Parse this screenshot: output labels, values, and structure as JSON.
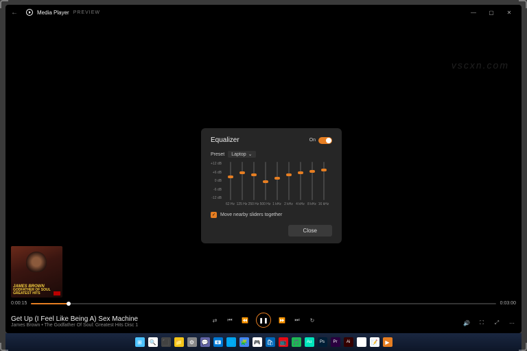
{
  "titlebar": {
    "app": "Media Player",
    "badge": "PREVIEW"
  },
  "album": {
    "line1": "JAMES BROWN",
    "line2": "GODFATHER OF SOUL",
    "line3": "GREATEST HITS"
  },
  "seek": {
    "elapsed": "0:00:15",
    "total": "0:03:00",
    "pct": 8
  },
  "now": {
    "song": "Get Up (I Feel Like Being A) Sex Machine",
    "artist": "James Brown • The Godfather Of Soul: Greatest Hits Disc 1"
  },
  "dialog": {
    "title": "Equalizer",
    "toggle_label": "On",
    "preset_label": "Preset",
    "preset_value": "Laptop",
    "scale": [
      "+12 dB",
      "+6 dB",
      "0 dB",
      "-6 dB",
      "-12 dB"
    ],
    "bands": [
      {
        "label": "62 Hz",
        "pos": 35
      },
      {
        "label": "125 Hz",
        "pos": 25
      },
      {
        "label": "250 Hz",
        "pos": 30
      },
      {
        "label": "500 Hz",
        "pos": 48
      },
      {
        "label": "1 kHz",
        "pos": 40
      },
      {
        "label": "2 kHz",
        "pos": 30
      },
      {
        "label": "4 kHz",
        "pos": 25
      },
      {
        "label": "8 kHz",
        "pos": 22
      },
      {
        "label": "16 kHz",
        "pos": 18
      }
    ],
    "check_label": "Move nearby sliders together",
    "close": "Close"
  },
  "watermark": "vscxn.com",
  "taskbar_icons": [
    "⊞",
    "🔍",
    "⬛",
    "📁",
    "⚙",
    "💬",
    "📧",
    "🌐",
    "🧩",
    "🎮",
    "🛍",
    "📺",
    "🎵",
    "Au",
    "Ps",
    "Pr",
    "Ai",
    "🗂",
    "📝",
    "▶"
  ]
}
